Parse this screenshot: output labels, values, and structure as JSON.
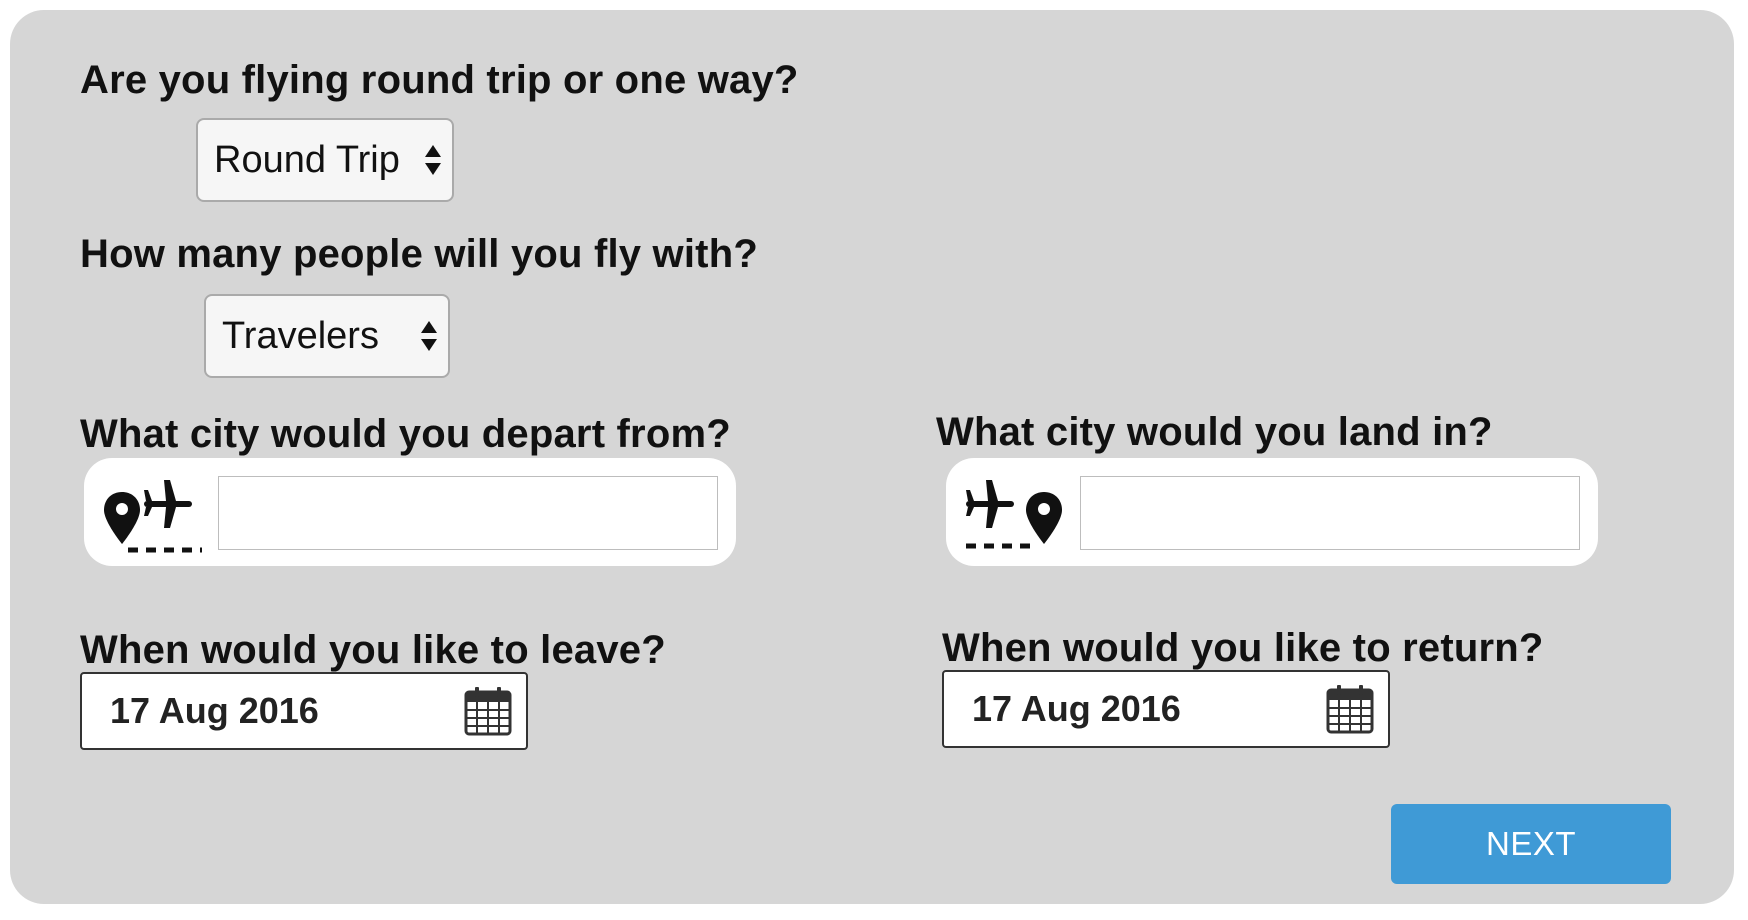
{
  "trip_type": {
    "question": "Are you flying round trip or one way?",
    "selected": "Round Trip"
  },
  "travelers": {
    "question": "How many people will you fly with?",
    "selected": "Travelers"
  },
  "depart_city": {
    "question": "What city would you depart from?",
    "value": ""
  },
  "land_city": {
    "question": "What city would you land in?",
    "value": ""
  },
  "leave_date": {
    "question": "When would you like to leave?",
    "value": "17 Aug 2016"
  },
  "return_date": {
    "question": "When would you like to return?",
    "value": "17 Aug 2016"
  },
  "next_button": {
    "label": "NEXT"
  },
  "colors": {
    "panel_background": "#d6d6d6",
    "button_accent": "#3f9ad6"
  },
  "icons": {
    "depart": "pin-plane-depart-icon",
    "land": "plane-pin-arrive-icon",
    "calendar": "calendar-icon",
    "select_arrows": "up-down-arrows-icon"
  }
}
